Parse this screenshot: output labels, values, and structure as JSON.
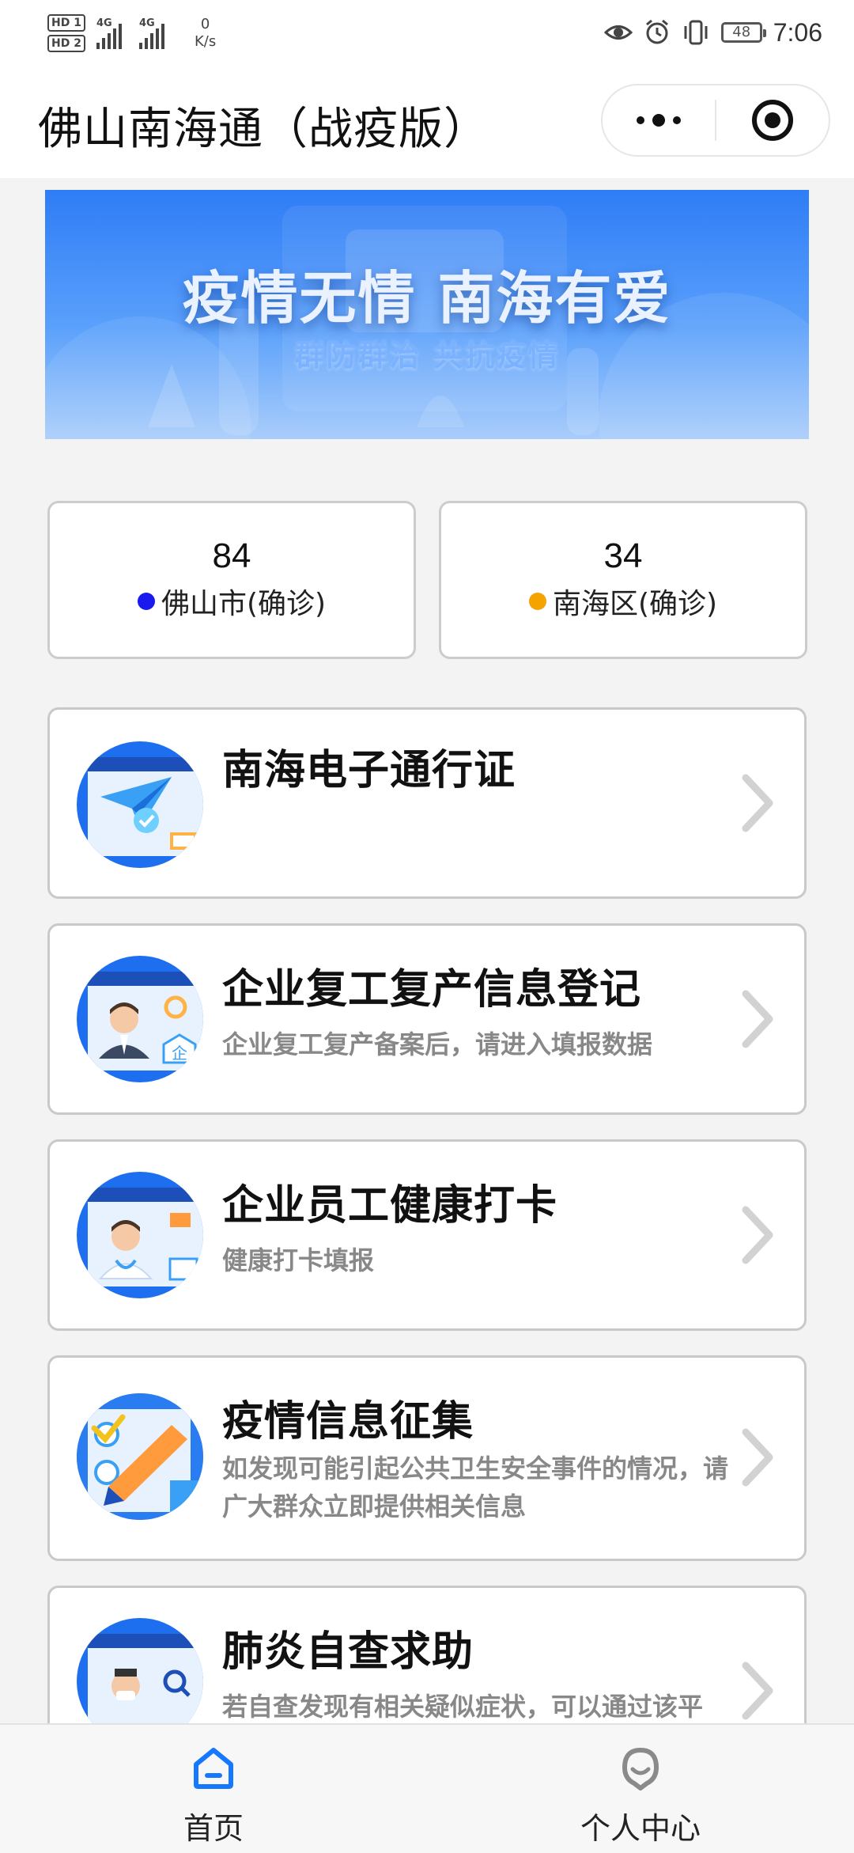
{
  "status_bar": {
    "hd1": "HD 1",
    "hd2": "HD 2",
    "network1": "4G",
    "network2": "4G",
    "net_speed_value": "0",
    "net_speed_unit": "K/s",
    "battery": "48",
    "time": "7:06"
  },
  "nav": {
    "title": "佛山南海通（战疫版）"
  },
  "banner": {
    "title": "疫情无情 南海有爱",
    "subtitle": "群防群治 共抗疫情"
  },
  "stats": [
    {
      "value": "84",
      "label": "佛山市(确诊)",
      "color": "#1a1aee"
    },
    {
      "value": "34",
      "label": "南海区(确诊)",
      "color": "#f5a300"
    }
  ],
  "services": [
    {
      "title": "南海电子通行证",
      "subtitle": "",
      "icon": "paper-plane-icon"
    },
    {
      "title": "企业复工复产信息登记",
      "subtitle": "企业复工复产备案后，请进入填报数据",
      "icon": "business-person-icon"
    },
    {
      "title": "企业员工健康打卡",
      "subtitle": "健康打卡填报",
      "icon": "doctor-icon"
    },
    {
      "title": "疫情信息征集",
      "subtitle": "如发现可能引起公共卫生安全事件的情况，请广大群众立即提供相关信息",
      "icon": "checklist-pen-icon"
    },
    {
      "title": "肺炎自查求助",
      "subtitle": "若自查发现有相关疑似症状，可以通过该平",
      "icon": "doctor-search-icon"
    }
  ],
  "tabs": [
    {
      "label": "首页",
      "icon": "home-icon",
      "active": true,
      "color": "#1677ff"
    },
    {
      "label": "个人中心",
      "icon": "profile-icon",
      "active": false,
      "color": "#888888"
    }
  ]
}
